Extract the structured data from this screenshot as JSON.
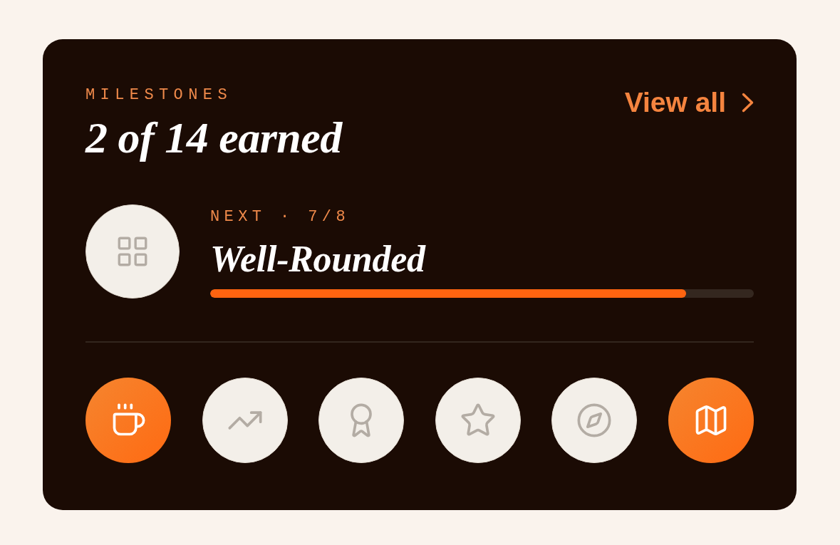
{
  "header": {
    "eyebrow": "MILESTONES",
    "title": "2 of 14 earned",
    "link": "View all"
  },
  "next": {
    "eyebrow": "NEXT · 7/8",
    "name": "Well-Rounded",
    "earned": false,
    "level": 0.875
  },
  "badges": [
    {
      "earned": true
    },
    {
      "earned": false
    },
    {
      "earned": false
    },
    {
      "earned": false
    },
    {
      "earned": false
    },
    {
      "earned": true
    }
  ]
}
